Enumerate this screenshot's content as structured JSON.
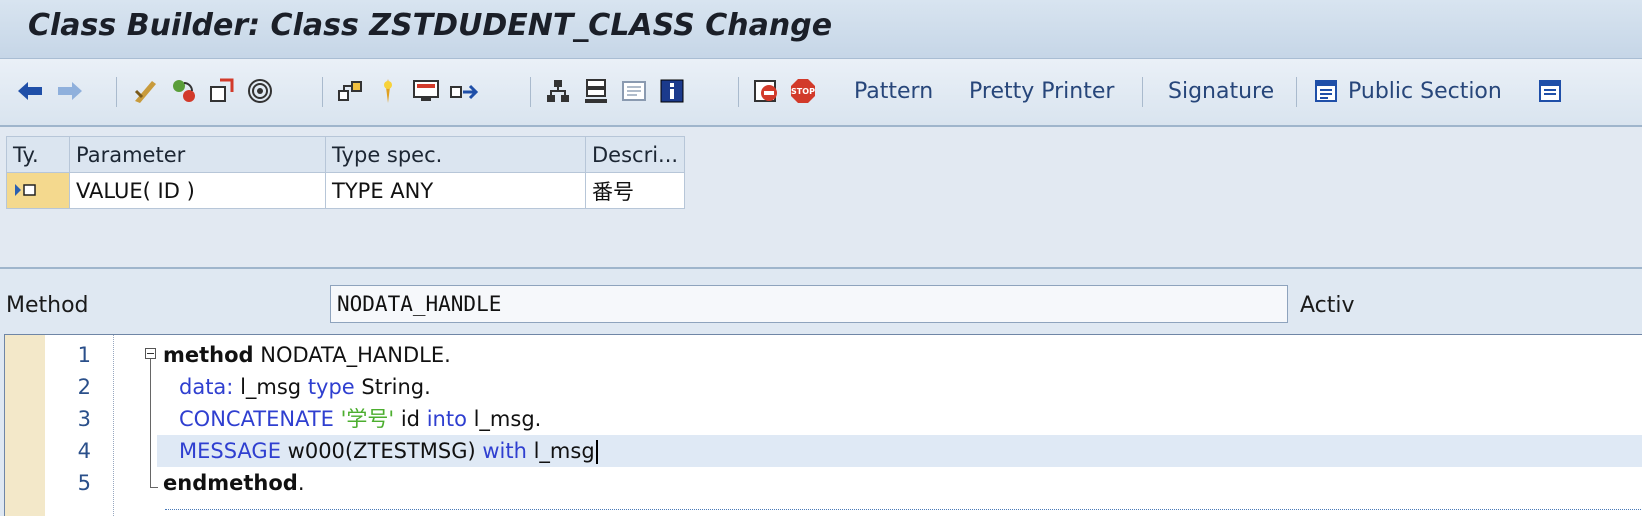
{
  "window": {
    "title": "Class Builder: Class ZSTDUDENT_CLASS Change"
  },
  "toolbar": {
    "icons": [
      "back-arrow-icon",
      "forward-arrow-icon",
      "check-icon",
      "toggle-icon",
      "activate-icon",
      "test-icon",
      "where-used-icon",
      "display-object-list-icon",
      "navigation-window-icon",
      "other-object-icon",
      "hierarchy-icon",
      "local-types-icon",
      "documentation-icon",
      "info-icon",
      "macros-icon",
      "stop-icon"
    ],
    "pattern_label": "Pattern",
    "pretty_printer_label": "Pretty Printer",
    "signature_label": "Signature",
    "public_section_label": "Public Section"
  },
  "params": {
    "columns": [
      "Ty.",
      "Parameter",
      "Type spec.",
      "Descri..."
    ],
    "rows": [
      {
        "type_icon": "importing-param-icon",
        "parameter": "VALUE( ID )",
        "type_spec": "TYPE ANY",
        "description": "番号"
      }
    ]
  },
  "method": {
    "label": "Method",
    "name": "NODATA_HANDLE",
    "status": "Activ"
  },
  "editor": {
    "line_numbers": [
      "1",
      "2",
      "3",
      "4",
      "5"
    ],
    "line1": {
      "kw": "method",
      "rest": " NODATA_HANDLE."
    },
    "line2": {
      "kw1": "data:",
      "mid": " l_msg ",
      "kw2": "type",
      "rest": " String."
    },
    "line3": {
      "kw1": "CONCATENATE",
      "str": " '学号' ",
      "mid": " id ",
      "kw2": "into",
      "rest": " l_msg."
    },
    "line4": {
      "kw1": "MESSAGE",
      "mid": " w000(ZTESTMSG) ",
      "kw2": "with",
      "rest": " l_msg"
    },
    "line5": {
      "kw": "endmethod",
      "rest": "."
    }
  },
  "colors": {
    "keyword": "#2f3fd0",
    "string": "#4cae2f",
    "title": "#1b1f28",
    "toolbar_text": "#27467a"
  }
}
